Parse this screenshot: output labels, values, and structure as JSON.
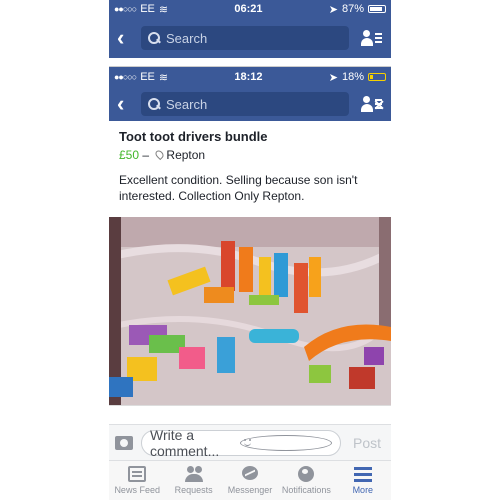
{
  "outer_status": {
    "carrier": "EE",
    "signal": "●●○○○",
    "time": "06:21",
    "battery": "87%",
    "battery_level": 0.87
  },
  "outer_nav": {
    "search_placeholder": "Search"
  },
  "inner_status": {
    "carrier": "EE",
    "signal": "●●○○○",
    "time": "18:12",
    "battery": "18%",
    "battery_level": 0.18
  },
  "inner_nav": {
    "search_placeholder": "Search"
  },
  "listing": {
    "title": "Toot toot drivers bundle",
    "price": "£50",
    "separator": "–",
    "location": "Repton",
    "description": "Excellent condition. Selling because son isn't interested. Collection Only Repton."
  },
  "composer": {
    "placeholder": "Write a comment...",
    "post_label": "Post"
  },
  "tabs": [
    {
      "label": "News Feed",
      "icon": "news-feed-icon"
    },
    {
      "label": "Requests",
      "icon": "friend-requests-icon"
    },
    {
      "label": "Messenger",
      "icon": "messenger-icon"
    },
    {
      "label": "Notifications",
      "icon": "globe-icon"
    },
    {
      "label": "More",
      "icon": "hamburger-icon",
      "active": true
    }
  ],
  "colors": {
    "brand": "#3b5998",
    "price": "#42b72a",
    "active_tab": "#4267b2"
  }
}
